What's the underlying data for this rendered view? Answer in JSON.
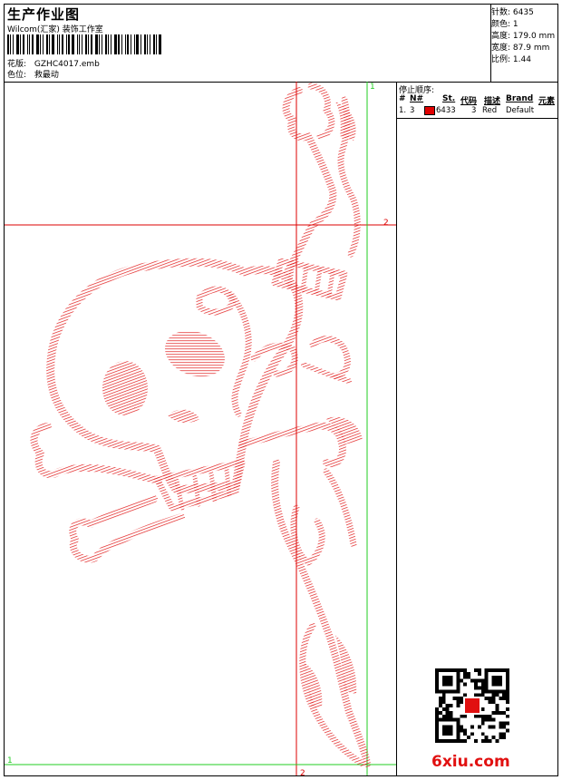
{
  "header": {
    "title": "生产作业图",
    "company": "Wilcom(汇家) 装饰工作室",
    "design_label": "花版:",
    "design_value": "GZHC4017.emb",
    "color_label": "色位:",
    "color_value": "救最动"
  },
  "stats": [
    {
      "label": "针数:",
      "value": "6435"
    },
    {
      "label": "颜色:",
      "value": "1"
    },
    {
      "label": "高度:",
      "value": "179.0 mm"
    },
    {
      "label": "宽度:",
      "value": "87.9 mm"
    },
    {
      "label": "比例:",
      "value": "1.44"
    }
  ],
  "stop_sequence": {
    "title": "停止顺序:",
    "columns": [
      "#",
      "N#",
      "St.",
      "代码",
      "描述",
      "Brand",
      "元素"
    ],
    "rows": [
      {
        "num": "1.",
        "needle": "3",
        "stitches": "6433",
        "code": "3",
        "description": "Red",
        "brand": "Default",
        "color": "#e00000"
      }
    ]
  },
  "guides": {
    "red_v_label": "2",
    "red_h_label": "2",
    "green_v_label": "1",
    "green_h_label": "1"
  },
  "colors": {
    "thread": "#e11a1a",
    "guide_green": "#22cc22",
    "guide_red": "#dd0000"
  },
  "watermark": "6xiu.com"
}
